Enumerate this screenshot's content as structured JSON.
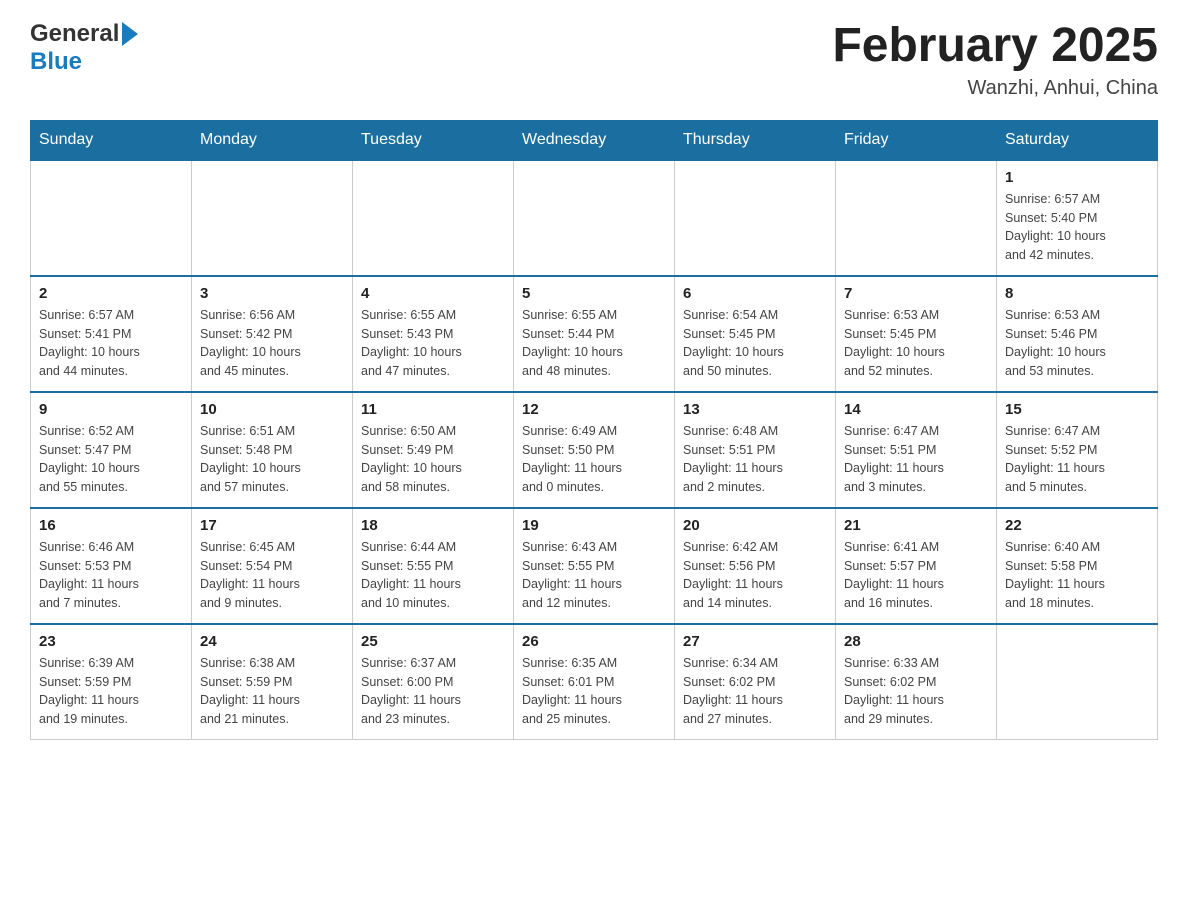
{
  "header": {
    "logo_general": "General",
    "logo_blue": "Blue",
    "month_title": "February 2025",
    "location": "Wanzhi, Anhui, China"
  },
  "weekdays": [
    "Sunday",
    "Monday",
    "Tuesday",
    "Wednesday",
    "Thursday",
    "Friday",
    "Saturday"
  ],
  "weeks": [
    [
      {
        "day": "",
        "info": ""
      },
      {
        "day": "",
        "info": ""
      },
      {
        "day": "",
        "info": ""
      },
      {
        "day": "",
        "info": ""
      },
      {
        "day": "",
        "info": ""
      },
      {
        "day": "",
        "info": ""
      },
      {
        "day": "1",
        "info": "Sunrise: 6:57 AM\nSunset: 5:40 PM\nDaylight: 10 hours\nand 42 minutes."
      }
    ],
    [
      {
        "day": "2",
        "info": "Sunrise: 6:57 AM\nSunset: 5:41 PM\nDaylight: 10 hours\nand 44 minutes."
      },
      {
        "day": "3",
        "info": "Sunrise: 6:56 AM\nSunset: 5:42 PM\nDaylight: 10 hours\nand 45 minutes."
      },
      {
        "day": "4",
        "info": "Sunrise: 6:55 AM\nSunset: 5:43 PM\nDaylight: 10 hours\nand 47 minutes."
      },
      {
        "day": "5",
        "info": "Sunrise: 6:55 AM\nSunset: 5:44 PM\nDaylight: 10 hours\nand 48 minutes."
      },
      {
        "day": "6",
        "info": "Sunrise: 6:54 AM\nSunset: 5:45 PM\nDaylight: 10 hours\nand 50 minutes."
      },
      {
        "day": "7",
        "info": "Sunrise: 6:53 AM\nSunset: 5:45 PM\nDaylight: 10 hours\nand 52 minutes."
      },
      {
        "day": "8",
        "info": "Sunrise: 6:53 AM\nSunset: 5:46 PM\nDaylight: 10 hours\nand 53 minutes."
      }
    ],
    [
      {
        "day": "9",
        "info": "Sunrise: 6:52 AM\nSunset: 5:47 PM\nDaylight: 10 hours\nand 55 minutes."
      },
      {
        "day": "10",
        "info": "Sunrise: 6:51 AM\nSunset: 5:48 PM\nDaylight: 10 hours\nand 57 minutes."
      },
      {
        "day": "11",
        "info": "Sunrise: 6:50 AM\nSunset: 5:49 PM\nDaylight: 10 hours\nand 58 minutes."
      },
      {
        "day": "12",
        "info": "Sunrise: 6:49 AM\nSunset: 5:50 PM\nDaylight: 11 hours\nand 0 minutes."
      },
      {
        "day": "13",
        "info": "Sunrise: 6:48 AM\nSunset: 5:51 PM\nDaylight: 11 hours\nand 2 minutes."
      },
      {
        "day": "14",
        "info": "Sunrise: 6:47 AM\nSunset: 5:51 PM\nDaylight: 11 hours\nand 3 minutes."
      },
      {
        "day": "15",
        "info": "Sunrise: 6:47 AM\nSunset: 5:52 PM\nDaylight: 11 hours\nand 5 minutes."
      }
    ],
    [
      {
        "day": "16",
        "info": "Sunrise: 6:46 AM\nSunset: 5:53 PM\nDaylight: 11 hours\nand 7 minutes."
      },
      {
        "day": "17",
        "info": "Sunrise: 6:45 AM\nSunset: 5:54 PM\nDaylight: 11 hours\nand 9 minutes."
      },
      {
        "day": "18",
        "info": "Sunrise: 6:44 AM\nSunset: 5:55 PM\nDaylight: 11 hours\nand 10 minutes."
      },
      {
        "day": "19",
        "info": "Sunrise: 6:43 AM\nSunset: 5:55 PM\nDaylight: 11 hours\nand 12 minutes."
      },
      {
        "day": "20",
        "info": "Sunrise: 6:42 AM\nSunset: 5:56 PM\nDaylight: 11 hours\nand 14 minutes."
      },
      {
        "day": "21",
        "info": "Sunrise: 6:41 AM\nSunset: 5:57 PM\nDaylight: 11 hours\nand 16 minutes."
      },
      {
        "day": "22",
        "info": "Sunrise: 6:40 AM\nSunset: 5:58 PM\nDaylight: 11 hours\nand 18 minutes."
      }
    ],
    [
      {
        "day": "23",
        "info": "Sunrise: 6:39 AM\nSunset: 5:59 PM\nDaylight: 11 hours\nand 19 minutes."
      },
      {
        "day": "24",
        "info": "Sunrise: 6:38 AM\nSunset: 5:59 PM\nDaylight: 11 hours\nand 21 minutes."
      },
      {
        "day": "25",
        "info": "Sunrise: 6:37 AM\nSunset: 6:00 PM\nDaylight: 11 hours\nand 23 minutes."
      },
      {
        "day": "26",
        "info": "Sunrise: 6:35 AM\nSunset: 6:01 PM\nDaylight: 11 hours\nand 25 minutes."
      },
      {
        "day": "27",
        "info": "Sunrise: 6:34 AM\nSunset: 6:02 PM\nDaylight: 11 hours\nand 27 minutes."
      },
      {
        "day": "28",
        "info": "Sunrise: 6:33 AM\nSunset: 6:02 PM\nDaylight: 11 hours\nand 29 minutes."
      },
      {
        "day": "",
        "info": ""
      }
    ]
  ]
}
